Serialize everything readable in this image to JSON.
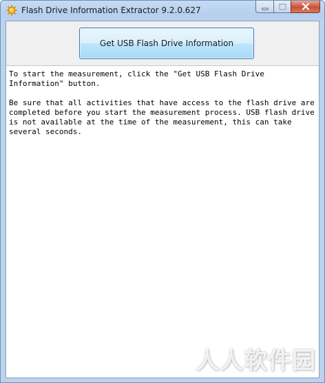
{
  "window": {
    "title": "Flash Drive Information Extractor 9.2.0.627"
  },
  "toolbar": {
    "get_info_label": "Get USB Flash Drive Information"
  },
  "output": {
    "paragraphs": [
      "To start the measurement, click the \"Get USB Flash Drive Information\" button.",
      "Be sure that all activities that have access to the flash drive are completed before you start the measurement process. USB flash drive is not available at the time of the measurement, this can take several seconds."
    ]
  },
  "watermark": {
    "text": "人人软件园"
  },
  "icons": {
    "app": "sun-gear-icon",
    "minimize": "minimize-icon",
    "maximize": "maximize-icon",
    "close": "close-icon"
  },
  "colors": {
    "button_border": "#3c7fb1",
    "close_button": "#c7513b",
    "titlebar": "#c6dbf3"
  }
}
